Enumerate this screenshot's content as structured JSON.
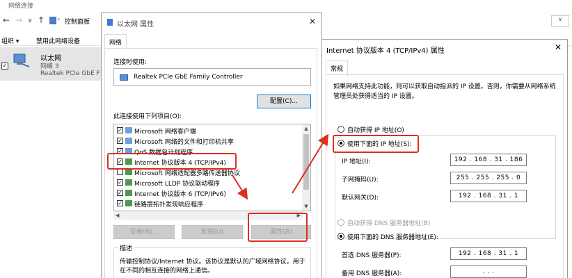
{
  "explorer": {
    "title": "网络连接",
    "address": "控制面板",
    "address_right": "∨",
    "cmd_organize": "组织 ▾",
    "cmd_disable": "禁用此网络设备",
    "adapter": {
      "name": "以太网",
      "network": "网络 3",
      "device": "Realtek PCIe GbE F"
    }
  },
  "dialog_ethernet": {
    "title": "以太网 属性",
    "close": "✕",
    "tab": "网络",
    "connect_using_label": "连接时使用:",
    "controller": "Realtek PCIe GbE Family Controller",
    "configure_button": "配置(C)...",
    "items_label": "此连接使用下列项目(O):",
    "items": [
      {
        "checked": true,
        "label": "Microsoft 网络客户端"
      },
      {
        "checked": true,
        "label": "Microsoft 网络的文件和打印机共享"
      },
      {
        "checked": true,
        "label": "QoS 数据包计划程序"
      },
      {
        "checked": true,
        "label": "Internet 协议版本 4 (TCP/IPv4)"
      },
      {
        "checked": false,
        "label": "Microsoft 网络适配器多路传送器协议"
      },
      {
        "checked": true,
        "label": "Microsoft LLDP 协议驱动程序"
      },
      {
        "checked": true,
        "label": "Internet 协议版本 6 (TCP/IPv6)"
      },
      {
        "checked": true,
        "label": "链路层拓扑发现响应程序"
      }
    ],
    "install_button": "安装(N)...",
    "uninstall_button": "卸载(U)",
    "properties_button": "属性(R)",
    "description_heading": "描述",
    "description_text": "传输控制协议/Internet 协议。该协议是默认的广域网络协议，用于在不同的相互连接的网络上通信。"
  },
  "dialog_ipv4": {
    "title": "Internet 协议版本 4 (TCP/IPv4) 属性",
    "close": "✕",
    "tab": "常规",
    "intro": "如果网络支持此功能，则可以获取自动指派的 IP 设置。否则，你需要从网络系统管理员处获得适当的 IP 设置。",
    "auto_ip": "自动获得 IP 地址(O)",
    "manual_ip": "使用下面的 IP 地址(S):",
    "ip_label": "IP 地址(I):",
    "ip_value": "192 . 168 . 31 . 186",
    "mask_label": "子网掩码(U):",
    "mask_value": "255 . 255 . 255 . 0",
    "gateway_label": "默认网关(D):",
    "gateway_value": "192 . 168 . 31 . 1",
    "auto_dns": "自动获得 DNS 服务器地址(B)",
    "manual_dns": "使用下面的 DNS 服务器地址(E):",
    "pref_dns_label": "首选 DNS 服务器(P):",
    "pref_dns_value": "192 . 168 . 31 . 1",
    "alt_dns_label": "备用 DNS 服务器(A):",
    "alt_dns_value": ".       .       ."
  },
  "colors": {
    "highlight": "#d9301f",
    "accent": "#0078d7"
  }
}
